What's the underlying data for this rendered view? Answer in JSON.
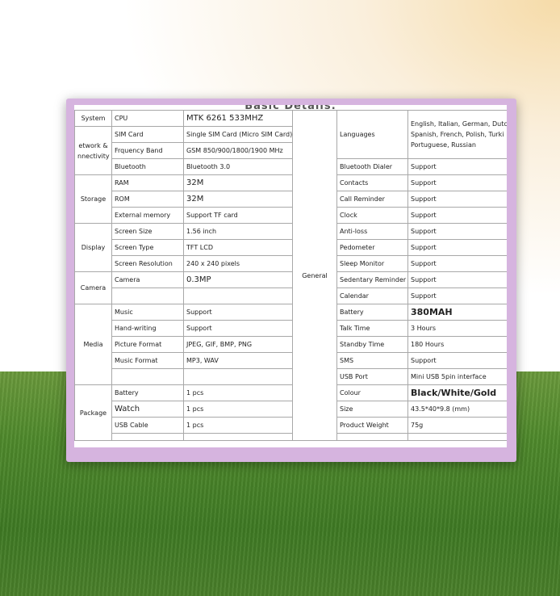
{
  "document": {
    "header": "Basic Details:",
    "left": {
      "system_category": "System",
      "cpu_label": "CPU",
      "cpu_value": "MTK 6261 533MHZ",
      "network_category_1": "etwork &",
      "network_category_2": "nnectivity",
      "sim_label": "SIM Card",
      "sim_value": "Single SIM Card (Micro SIM Card)",
      "freq_label": "Frquency Band",
      "freq_value": "GSM 850/900/1800/1900 MHz",
      "bt_label": "Bluetooth",
      "bt_value": "Bluetooth 3.0",
      "storage_category": "Storage",
      "ram_label": "RAM",
      "ram_value": "32M",
      "rom_label": "ROM",
      "rom_value": "32M",
      "ext_mem_label": "External memory",
      "ext_mem_value": "Support TF card",
      "display_category": "Display",
      "screen_size_label": "Screen Size",
      "screen_size_value": "1.56 inch",
      "screen_type_label": "Screen Type",
      "screen_type_value": "TFT LCD",
      "screen_res_label": "Screen Resolution",
      "screen_res_value": "240 x 240 pixels",
      "camera_category": "Camera",
      "camera_label": "Camera",
      "camera_value": "0.3MP",
      "media_category": "Media",
      "music_label": "Music",
      "music_value": "Support",
      "handwriting_label": "Hand-writing",
      "handwriting_value": "Support",
      "picture_format_label": "Picture Format",
      "picture_format_value": "JPEG, GIF, BMP, PNG",
      "music_format_label": "Music Format",
      "music_format_value": "MP3, WAV",
      "package_category": "Package",
      "battery_label": "Battery",
      "battery_value": "1 pcs",
      "watch_label": "Watch",
      "watch_value": "1 pcs",
      "usb_cable_label": "USB Cable",
      "usb_cable_value": "1 pcs"
    },
    "general_category": "General",
    "right": {
      "languages_label": "Languages",
      "languages_line1": "English, Italian, German, Dutc",
      "languages_line2": "Spanish, French, Polish, Turki",
      "languages_line3": "Portuguese, Russian",
      "bt_dialer_label": "Bluetooth Dialer",
      "bt_dialer_value": "Support",
      "contacts_label": "Contacts",
      "contacts_value": "Support",
      "call_reminder_label": "Call Reminder",
      "call_reminder_value": "Support",
      "clock_label": "Clock",
      "clock_value": "Support",
      "anti_loss_label": "Anti-loss",
      "anti_loss_value": "Support",
      "pedometer_label": "Pedometer",
      "pedometer_value": "Support",
      "sleep_monitor_label": "Sleep Monitor",
      "sleep_monitor_value": "Support",
      "sedentary_label": "Sedentary Reminder",
      "sedentary_value": "Support",
      "calendar_label": "Calendar",
      "calendar_value": "Support",
      "battery_label": "Battery",
      "battery_value": "380MAH",
      "talk_time_label": "Talk Time",
      "talk_time_value": "3 Hours",
      "standby_label": "Standby Time",
      "standby_value": "180 Hours",
      "sms_label": "SMS",
      "sms_value": "Support",
      "usb_port_label": "USB Port",
      "usb_port_value": "Mini USB 5pin interface",
      "colour_label": "Colour",
      "colour_value": "Black/White/Gold",
      "size_label": "Size",
      "size_value": "43.5*40*9.8 (mm)",
      "weight_label": "Product Weight",
      "weight_value": "75g"
    }
  },
  "colors": {
    "frame": "#d6b4df",
    "grass": "#4f8a2c",
    "sky_glow": "#f6dba8"
  }
}
